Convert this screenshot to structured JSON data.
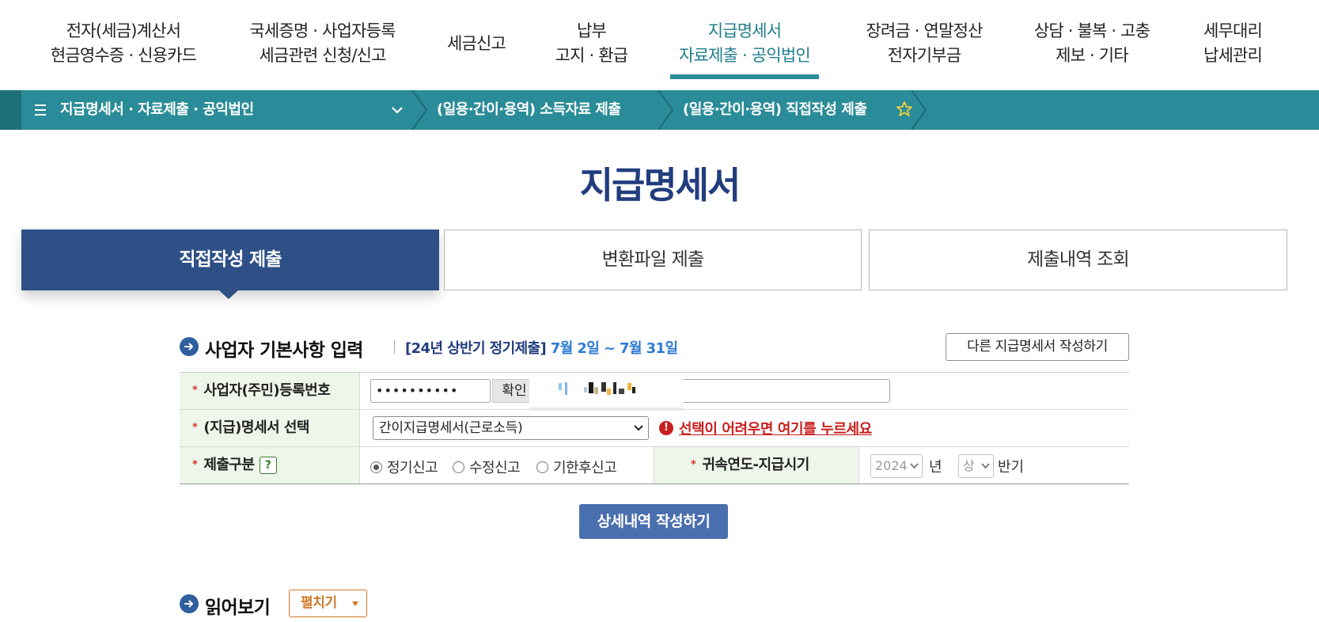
{
  "nav": {
    "items": [
      {
        "line1": "전자(세금)계산서",
        "line2": "현금영수증 · 신용카드"
      },
      {
        "line1": "국세증명 · 사업자등록",
        "line2": "세금관련 신청/신고"
      },
      {
        "line1": "세금신고",
        "line2": ""
      },
      {
        "line1": "납부",
        "line2": "고지 · 환급"
      },
      {
        "line1": "지급명세서",
        "line2": "자료제출 · 공익법인"
      },
      {
        "line1": "장려금 · 연말정산",
        "line2": "전자기부금"
      },
      {
        "line1": "상담 · 불복 · 고충",
        "line2": "제보 · 기타"
      },
      {
        "line1": "세무대리",
        "line2": "납세관리"
      }
    ],
    "active_index": 4,
    "accent_color": "#2b8c99"
  },
  "breadcrumb": {
    "items": [
      "지급명세서 · 자료제출 · 공익법인",
      "(일용·간이·용역) 소득자료 제출",
      "(일용·간이·용역) 직접작성 제출"
    ],
    "menu_icon": "hamburger-icon",
    "dropdown_icon": "chevron-down-icon",
    "favorite_icon": "star-outline-icon"
  },
  "page": {
    "title": "지급명세서",
    "title_color": "#213d7e"
  },
  "tabs": [
    {
      "label": "직접작성 제출",
      "active": true
    },
    {
      "label": "변환파일 제출",
      "active": false
    },
    {
      "label": "제출내역 조회",
      "active": false
    }
  ],
  "section_basic": {
    "title": "사업자 기본사항 입력",
    "period_label": "[24년 상반기 정기제출]",
    "period_dates": "7월 2일 ~ 7월 31일",
    "other_button": "다른 지급명세서 작성하기"
  },
  "form": {
    "required_mark": "*",
    "biz_no": {
      "label": "사업자(주민)등록번호",
      "value": "••••••••••",
      "confirm": "확인"
    },
    "statement": {
      "label": "(지급)명세서 선택",
      "selected": "간이지급명세서(근로소득)",
      "help_link": "선택이 어려우면 여기를 누르세요",
      "warn_icon": "!"
    },
    "submit_type": {
      "label": "제출구분",
      "help": "?",
      "options": [
        "정기신고",
        "수정신고",
        "기한후신고"
      ],
      "selected_index": 0
    },
    "period": {
      "label": "귀속연도-지급시기",
      "year": "2024",
      "year_unit": "년",
      "half": "상",
      "half_unit": "반기"
    }
  },
  "detail_button": "상세내역 작성하기",
  "section_read": {
    "title": "읽어보기",
    "expand": "펼치기"
  }
}
